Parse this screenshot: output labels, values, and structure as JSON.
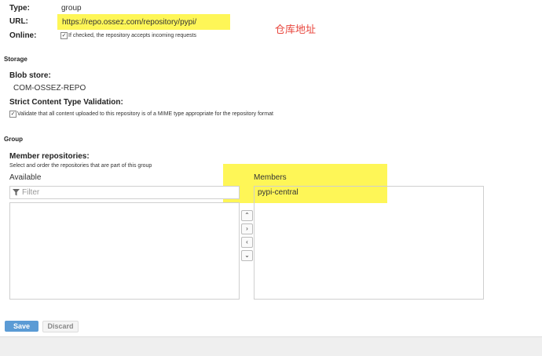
{
  "fields": {
    "type_label": "Type:",
    "type_value": "group",
    "url_label": "URL:",
    "url_value": "https://repo.ossez.com/repository/pypi/",
    "online_label": "Online:",
    "online_desc": "If checked, the repository accepts incoming requests",
    "online_checked": "✓"
  },
  "annotation": {
    "text": "仓库地址",
    "color": "#e8453c"
  },
  "storage": {
    "title": "Storage",
    "blob_label": "Blob store:",
    "blob_value": "COM-OSSEZ-REPO",
    "strict_label": "Strict Content Type Validation:",
    "strict_desc": "Validate that all content uploaded to this repository is of a MIME type appropriate for the repository format",
    "strict_checked": "✓"
  },
  "group": {
    "title": "Group",
    "members_label": "Member repositories:",
    "members_desc": "Select and order the repositories that are part of this group",
    "available_label": "Available",
    "filter_placeholder": "Filter",
    "members_col_label": "Members",
    "members": [
      "pypi-central"
    ],
    "arrows": [
      "⌃",
      "›",
      "‹",
      "⌄"
    ]
  },
  "buttons": {
    "save": "Save",
    "discard": "Discard"
  }
}
